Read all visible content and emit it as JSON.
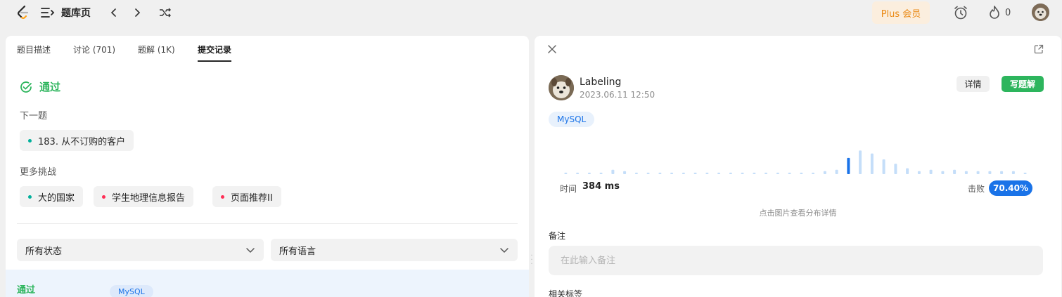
{
  "topbar": {
    "title": "题库页",
    "plus_label": "Plus 会员",
    "fire_count": "0"
  },
  "tabs": [
    {
      "label": "题目描述"
    },
    {
      "label": "讨论 (701)"
    },
    {
      "label": "题解 (1K)"
    },
    {
      "label": "提交记录"
    }
  ],
  "active_tab": "提交记录",
  "result": {
    "status": "通过",
    "next_label": "下一题",
    "next_problem": "183. 从不订购的客户",
    "more_label": "更多挑战",
    "challenges": [
      {
        "label": "大的国家",
        "dot_color": "#00af9b"
      },
      {
        "label": "学生地理信息报告",
        "dot_color": "#ff2d55"
      },
      {
        "label": "页面推荐II",
        "dot_color": "#ff2d55"
      }
    ]
  },
  "filters": {
    "status": "所有状态",
    "language": "所有语言"
  },
  "submission_row": {
    "status": "通过",
    "language": "MySQL"
  },
  "detail": {
    "username": "Labeling",
    "datetime": "2023.06.11 12:50",
    "detail_button": "详情",
    "write_button": "写题解",
    "language": "MySQL",
    "time_label": "时间",
    "time_value": "384 ms",
    "beat_label": "击败",
    "beat_value": "70.40%",
    "chart_hint": "点击图片查看分布详情",
    "note_label": "备注",
    "note_placeholder": "在此输入备注",
    "tags_label": "相关标签"
  },
  "colors": {
    "accent_green": "#2db55d",
    "accent_blue": "#1a73e8",
    "plus_orange": "#ea8a16"
  },
  "chart_data": {
    "type": "bar",
    "description_values": [
      0.05,
      0.05,
      0.05,
      0.05,
      0.15,
      0.1,
      0.05,
      0.05,
      0.05,
      0.05,
      0.05,
      0.05,
      0.05,
      0.05,
      0.05,
      0.05,
      0.05,
      0.05,
      0.05,
      0.05,
      0.05,
      0.05,
      0.1,
      0.15,
      0.55,
      0.8,
      0.7,
      0.5,
      0.35,
      0.2,
      0.1,
      0.15,
      0.1,
      0.15,
      0.1,
      0.1,
      0.1,
      0.1,
      0.1,
      0.05
    ],
    "highlight_index": 24
  }
}
